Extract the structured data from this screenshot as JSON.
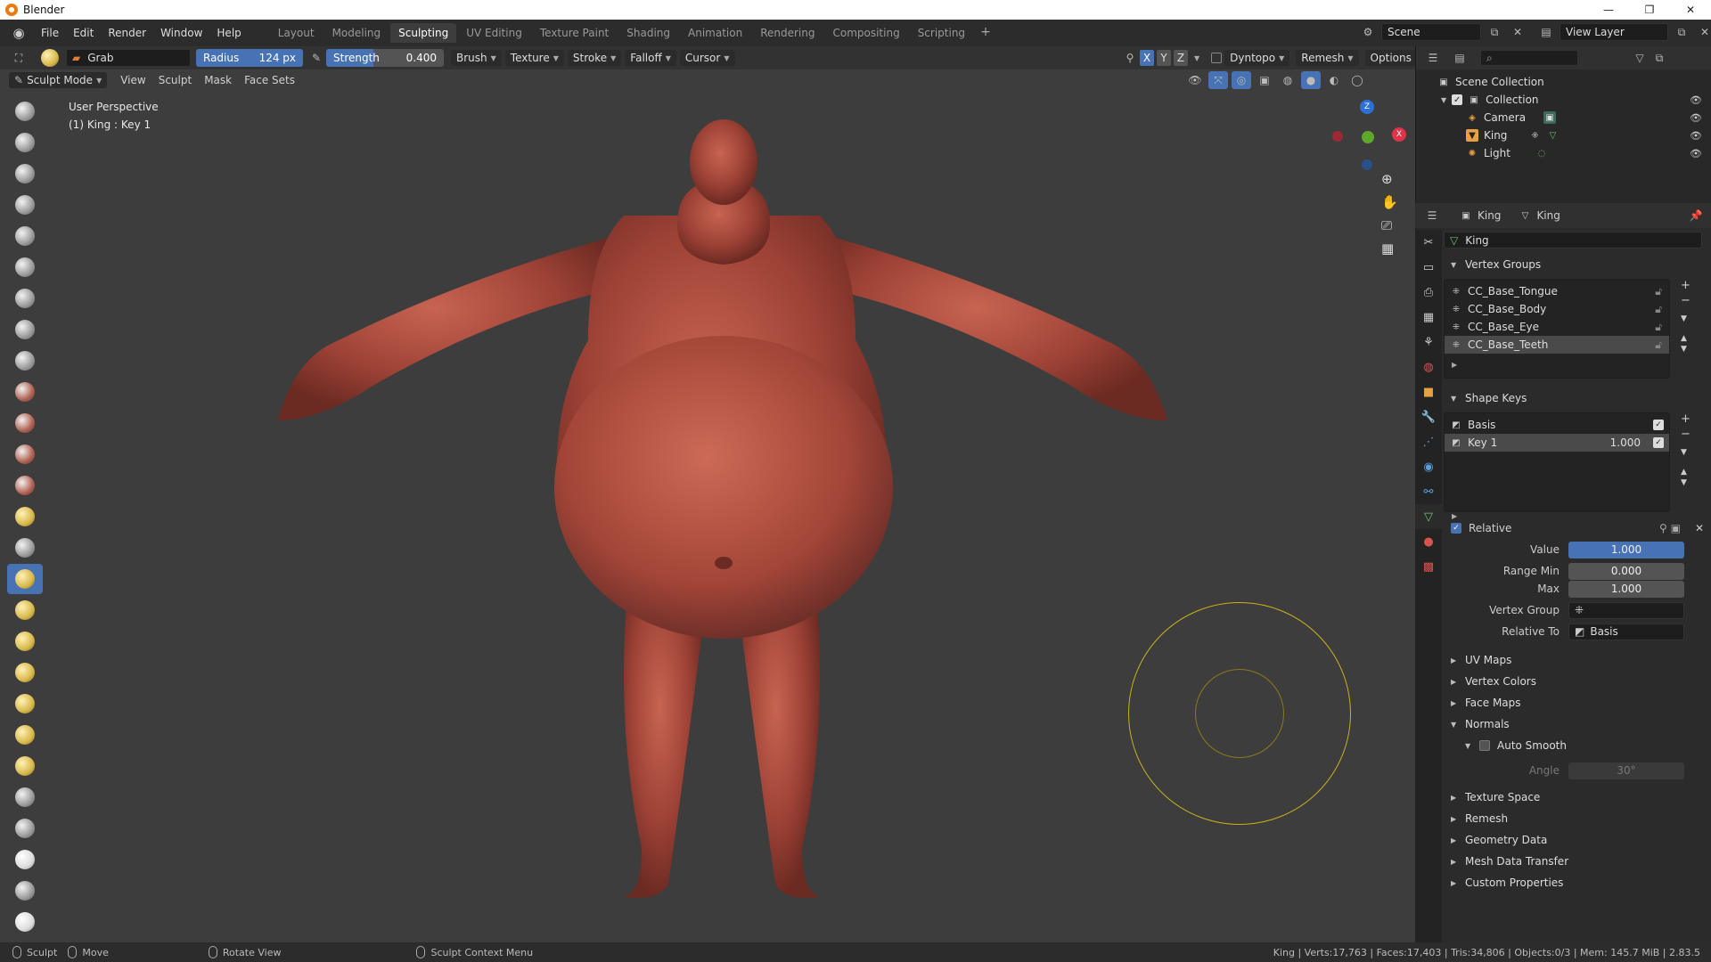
{
  "window": {
    "title": "Blender",
    "controls": [
      "—",
      "❐",
      "✕"
    ]
  },
  "menu": {
    "items": [
      "File",
      "Edit",
      "Render",
      "Window",
      "Help"
    ]
  },
  "workspaces": {
    "tabs": [
      "Layout",
      "Modeling",
      "Sculpting",
      "UV Editing",
      "Texture Paint",
      "Shading",
      "Animation",
      "Rendering",
      "Compositing",
      "Scripting"
    ],
    "active": "Sculpting",
    "add": "+"
  },
  "scene": {
    "name": "Scene",
    "view_layer": "View Layer"
  },
  "tool_settings": {
    "brush_name": "Grab",
    "radius_label": "Radius",
    "radius_value": "124 px",
    "strength_label": "Strength",
    "strength_value": "0.400",
    "dropdowns": [
      "Brush",
      "Texture",
      "Stroke",
      "Falloff",
      "Cursor"
    ],
    "axes": [
      "X",
      "Y",
      "Z"
    ],
    "dyntopo": "Dyntopo",
    "remesh": "Remesh",
    "options": "Options"
  },
  "viewport_header": {
    "mode": "Sculpt Mode",
    "menus": [
      "View",
      "Sculpt",
      "Mask",
      "Face Sets"
    ]
  },
  "viewport": {
    "perspective": "User Perspective",
    "object_info": "(1) King : Key 1",
    "gizmo": {
      "x": "X",
      "y": "Y",
      "z": "Z"
    }
  },
  "outliner": {
    "root": "Scene Collection",
    "collection": "Collection",
    "items": [
      {
        "name": "Camera",
        "icon": "camera-icon"
      },
      {
        "name": "King",
        "icon": "mesh-icon"
      },
      {
        "name": "Light",
        "icon": "light-icon"
      }
    ]
  },
  "properties": {
    "breadcrumb_object": "King",
    "breadcrumb_data": "King",
    "data_name": "King",
    "vertex_groups": {
      "title": "Vertex Groups",
      "items": [
        "CC_Base_Tongue",
        "CC_Base_Body",
        "CC_Base_Eye",
        "CC_Base_Teeth"
      ],
      "selected": "CC_Base_Teeth"
    },
    "shape_keys": {
      "title": "Shape Keys",
      "items": [
        {
          "name": "Basis",
          "value": ""
        },
        {
          "name": "Key 1",
          "value": "1.000"
        }
      ],
      "relative_label": "Relative",
      "value_label": "Value",
      "value": "1.000",
      "range_min_label": "Range Min",
      "range_min": "0.000",
      "max_label": "Max",
      "max": "1.000",
      "vertex_group_label": "Vertex Group",
      "vertex_group": "",
      "relative_to_label": "Relative To",
      "relative_to": "Basis"
    },
    "collapsed_panels": [
      "UV Maps",
      "Vertex Colors",
      "Face Maps"
    ],
    "normals": {
      "title": "Normals",
      "auto_smooth": "Auto Smooth",
      "angle_label": "Angle",
      "angle": "30°"
    },
    "more_panels": [
      "Texture Space",
      "Remesh",
      "Geometry Data",
      "Mesh Data Transfer",
      "Custom Properties"
    ]
  },
  "statusbar": {
    "sculpt": "Sculpt",
    "move": "Move",
    "rotate": "Rotate View",
    "context": "Sculpt Context Menu",
    "stats": "King | Verts:17,763 | Faces:17,403 | Tris:34,806 | Objects:0/3 | Mem: 145.7 MiB | 2.83.5"
  },
  "colors": {
    "accent": "#4772b3",
    "skin": "#a8463a",
    "brush_circle": "#c9b21a",
    "viewport_bg": "#3d3d3d"
  }
}
